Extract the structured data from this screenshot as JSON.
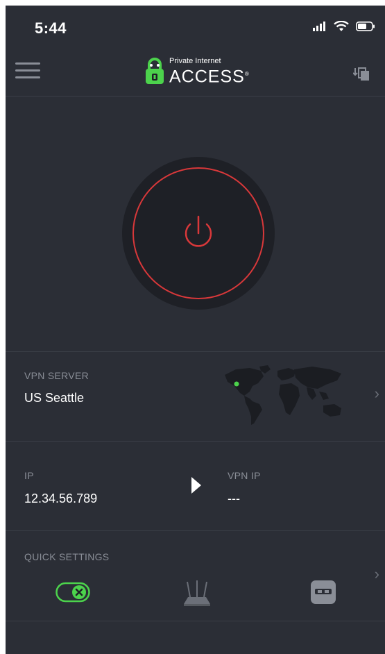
{
  "status_bar": {
    "time": "5:44",
    "icons": [
      "signal-icon",
      "wifi-icon",
      "battery-icon"
    ]
  },
  "header": {
    "menu_icon": "hamburger-menu-icon",
    "logo_small": "Private Internet",
    "logo_big": "ACCESS",
    "logo_trademark": "®",
    "region_icon": "region-switch-icon"
  },
  "connect": {
    "icon": "power-icon",
    "ring_color": "#d9383a"
  },
  "vpn_server": {
    "label": "VPN SERVER",
    "value": "US Seattle",
    "map_icon": "world-map-icon",
    "location_dot_color": "#4cd34c"
  },
  "ip": {
    "label": "IP",
    "value": "12.34.56.789",
    "vpn_label": "VPN IP",
    "vpn_value": "---"
  },
  "quick_settings": {
    "label": "QUICK SETTINGS",
    "items": [
      {
        "icon": "killswitch-toggle-icon",
        "color": "#4cd34c"
      },
      {
        "icon": "network-router-icon",
        "color": "#6b6f78"
      },
      {
        "icon": "private-browser-icon",
        "color": "#8a8e97"
      }
    ]
  },
  "chevron": "›",
  "colors": {
    "background": "#2b2e36",
    "accent_red": "#d9383a",
    "accent_green": "#4cd34c",
    "muted_text": "#8a8e97"
  }
}
